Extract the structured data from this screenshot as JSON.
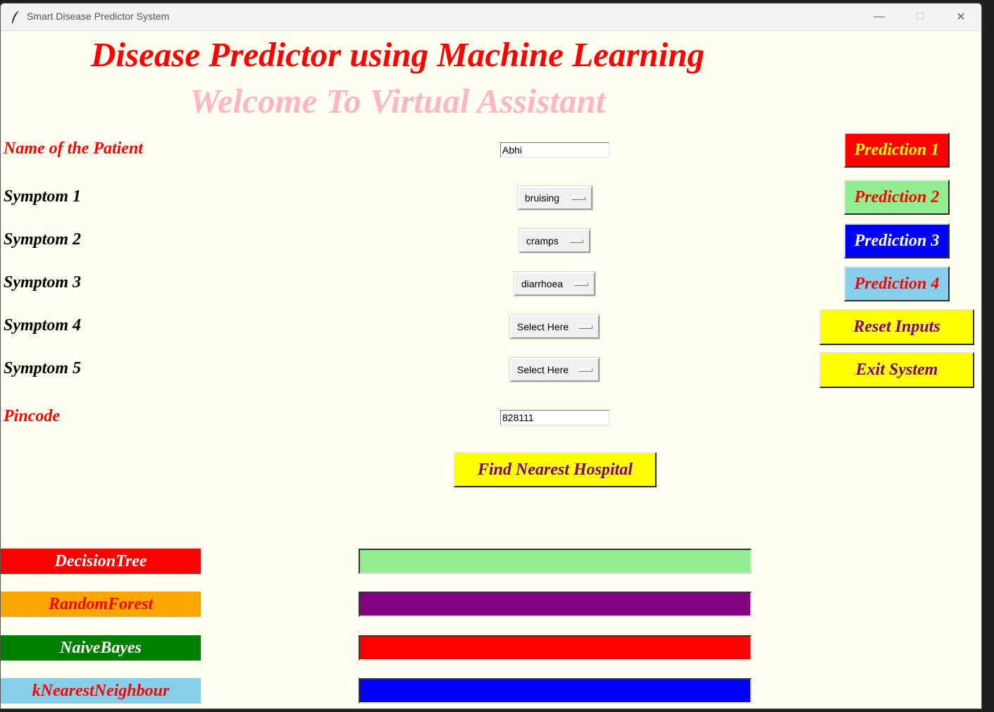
{
  "window": {
    "title": "Smart Disease Predictor System",
    "controls": {
      "minimize": "—",
      "maximize": "□",
      "close": "✕"
    }
  },
  "header": {
    "title": "Disease Predictor using Machine Learning",
    "subtitle": "Welcome To Virtual Assistant"
  },
  "form": {
    "name_label": "Name of the Patient",
    "name_value": "Abhi",
    "symptoms": [
      {
        "label": "Symptom 1",
        "value": "bruising"
      },
      {
        "label": "Symptom 2",
        "value": "cramps"
      },
      {
        "label": "Symptom 3",
        "value": "diarrhoea"
      },
      {
        "label": "Symptom 4",
        "value": "Select Here"
      },
      {
        "label": "Symptom 5",
        "value": "Select Here"
      }
    ],
    "pincode_label": "Pincode",
    "pincode_value": "828111",
    "find_hospital": "Find Nearest Hospital"
  },
  "buttons": {
    "prediction1": {
      "label": "Prediction 1",
      "bg": "#ff0000",
      "fg": "#ffff00"
    },
    "prediction2": {
      "label": "Prediction 2",
      "bg": "#90ee90",
      "fg": "#ff0000"
    },
    "prediction3": {
      "label": "Prediction 3",
      "bg": "#0000ff",
      "fg": "#ffffff"
    },
    "prediction4": {
      "label": "Prediction 4",
      "bg": "#87ceeb",
      "fg": "#ff0000"
    },
    "reset": {
      "label": "Reset Inputs",
      "bg": "#ffff00",
      "fg": "#800080"
    },
    "exit": {
      "label": "Exit System",
      "bg": "#ffff00",
      "fg": "#800080"
    }
  },
  "algorithms": [
    {
      "name": "DecisionTree",
      "bg": "#ff0000",
      "fg": "#ffffff",
      "result_bg": "#90ee90"
    },
    {
      "name": "RandomForest",
      "bg": "#ffa500",
      "fg": "#ff0000",
      "result_bg": "#800080"
    },
    {
      "name": "NaiveBayes",
      "bg": "#008000",
      "fg": "#ffffff",
      "result_bg": "#ff0000"
    },
    {
      "name": "kNearestNeighbour",
      "bg": "#87ceeb",
      "fg": "#ff0000",
      "result_bg": "#0000ff"
    }
  ]
}
